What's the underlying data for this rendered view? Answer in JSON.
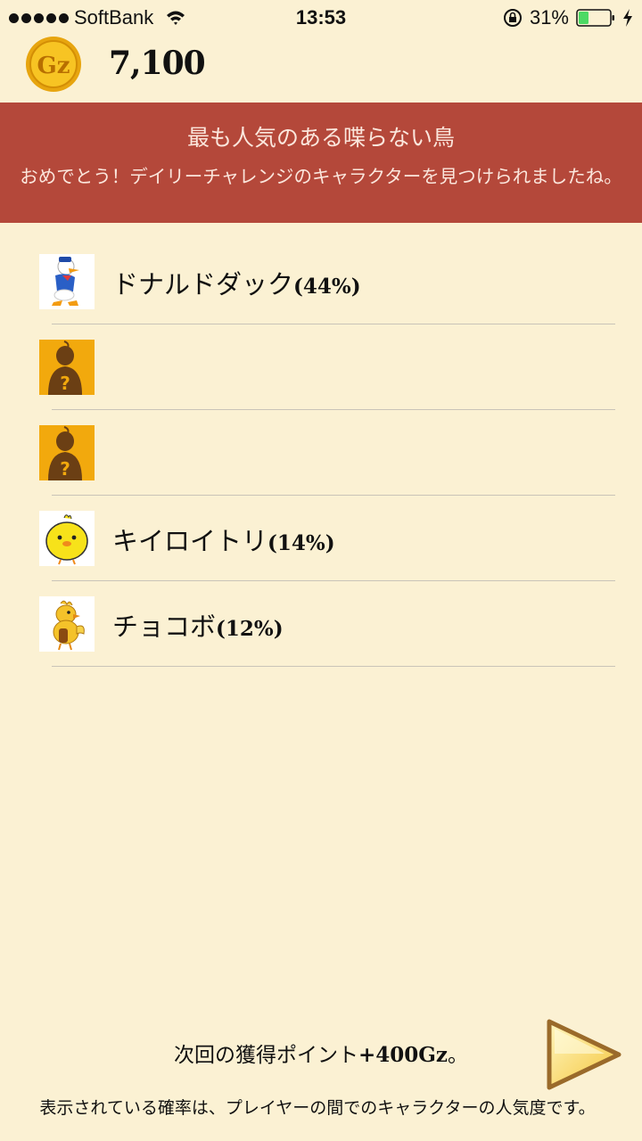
{
  "status_bar": {
    "carrier": "SoftBank",
    "time": "13:53",
    "battery": "31%"
  },
  "header": {
    "coin_label": "Gz",
    "points": "7,100"
  },
  "banner": {
    "title": "最も人気のある喋らない鳥",
    "message": "おめでとう！デイリーチャレンジのキャラクターを見つけられましたね。"
  },
  "answers": [
    {
      "icon": "donald-duck-icon",
      "name": "ドナルドダック",
      "percent": "(44%)"
    },
    {
      "icon": "unknown-character-icon",
      "name": "",
      "percent": ""
    },
    {
      "icon": "unknown-character-icon",
      "name": "",
      "percent": ""
    },
    {
      "icon": "kiiroitori-icon",
      "name": "キイロイトリ",
      "percent": "(14%)"
    },
    {
      "icon": "chocobo-icon",
      "name": "チョコボ",
      "percent": "(12%)"
    }
  ],
  "next_points": {
    "prefix": "次回の獲得ポイント",
    "amount": "+400Gz",
    "suffix": "。"
  },
  "footer_note": "表示されている確率は、プレイヤーの間でのキャラクターの人気度です。",
  "colors": {
    "background": "#fbf1d3",
    "banner": "#b4483a",
    "coin": "#f2b418"
  }
}
